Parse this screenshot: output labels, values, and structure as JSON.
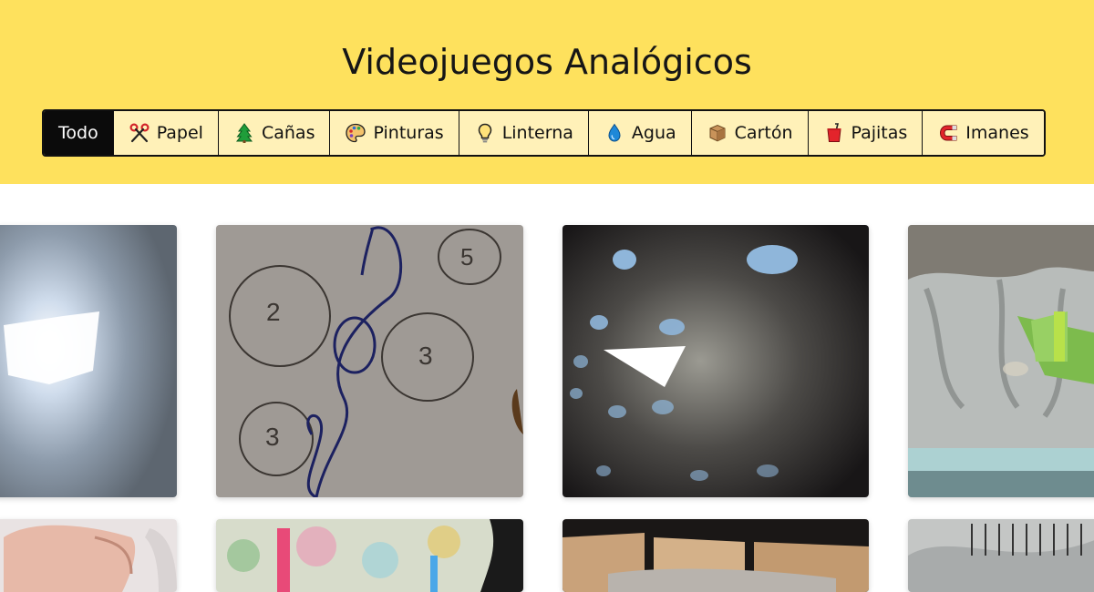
{
  "header": {
    "title": "Videojuegos Analógicos",
    "background_color": "#fee15d"
  },
  "filters": [
    {
      "label": "Todo",
      "icon": "none",
      "active": true
    },
    {
      "label": "Papel",
      "icon": "scissors-icon",
      "active": false
    },
    {
      "label": "Cañas",
      "icon": "tree-icon",
      "active": false
    },
    {
      "label": "Pinturas",
      "icon": "palette-icon",
      "active": false
    },
    {
      "label": "Linterna",
      "icon": "lightbulb-icon",
      "active": false
    },
    {
      "label": "Agua",
      "icon": "droplet-icon",
      "active": false
    },
    {
      "label": "Cartón",
      "icon": "box-icon",
      "active": false
    },
    {
      "label": "Pajitas",
      "icon": "cup-straw-icon",
      "active": false
    },
    {
      "label": "Imanes",
      "icon": "magnet-icon",
      "active": false
    }
  ],
  "gallery": {
    "items": [
      {
        "scene": "bright-light-blob"
      },
      {
        "scene": "drawn-circles-numbers",
        "numbers": [
          "2",
          "3",
          "3",
          "5"
        ]
      },
      {
        "scene": "paper-plane-shadow"
      },
      {
        "scene": "boat-on-water"
      },
      {
        "scene": "hand"
      },
      {
        "scene": "colorful-paper-tubes"
      },
      {
        "scene": "cardboard-boxes"
      },
      {
        "scene": "metal-springs"
      }
    ]
  }
}
